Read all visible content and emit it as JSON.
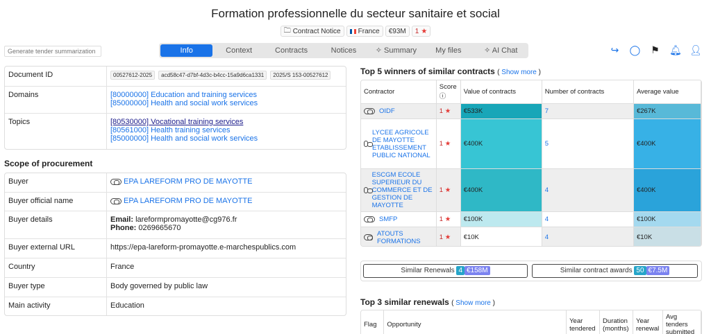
{
  "header": {
    "title": "Formation professionnelle du secteur sanitaire et social",
    "notice_type": "Contract Notice",
    "country": "France",
    "value": "€93M",
    "score": "1"
  },
  "summarize_placeholder": "Generate tender summarization",
  "tabs": [
    "Info",
    "Context",
    "Contracts",
    "Notices",
    "Summary",
    "My files",
    "AI Chat"
  ],
  "details": {
    "document_id_label": "Document ID",
    "document_ids": [
      "00527612-2025",
      "acd58c47-d7bf-4d3c-b4cc-15a9d6ca1331",
      "2025/S 153-00527612"
    ],
    "domains_label": "Domains",
    "domains": [
      "[80000000] Education and training services",
      "[85000000] Health and social work services"
    ],
    "topics_label": "Topics",
    "topics": [
      "[80530000] Vocational training services",
      "[80561000] Health training services",
      "[85000000] Health and social work services"
    ]
  },
  "scope": {
    "heading": "Scope of procurement",
    "buyer_label": "Buyer",
    "buyer": "EPA LAREFORM PRO DE MAYOTTE",
    "buyer_official_label": "Buyer official name",
    "buyer_official": "EPA LAREFORM PRO DE MAYOTTE",
    "buyer_details_label": "Buyer details",
    "email_label": "Email:",
    "email": "lareformpromayotte@cg976.fr",
    "phone_label": "Phone:",
    "phone": "0269665670",
    "url_label": "Buyer external URL",
    "url": "https://epa-lareform-promayotte.e-marchespublics.com",
    "country_label": "Country",
    "country": "France",
    "type_label": "Buyer type",
    "type": "Body governed by public law",
    "activity_label": "Main activity",
    "activity": "Education"
  },
  "winners": {
    "heading": "Top 5 winners of similar contracts",
    "show_more": "Show more",
    "headers": [
      "Contractor",
      "Score",
      "Value of contracts",
      "Number of contracts",
      "Average value"
    ],
    "rows": [
      {
        "name": "OIDF",
        "score": "1",
        "value": "€533K",
        "count": "7",
        "avg": "€267K"
      },
      {
        "name": "LYCEE AGRICOLE DE MAYOTTE ETABLISSEMENT PUBLIC NATIONAL",
        "score": "1",
        "value": "€400K",
        "count": "5",
        "avg": "€400K"
      },
      {
        "name": "ESCGM ECOLE SUPERIEUR DU COMMERCE ET DE GESTION DE MAYOTTE",
        "score": "1",
        "value": "€400K",
        "count": "4",
        "avg": "€400K"
      },
      {
        "name": "SMFP",
        "score": "1",
        "value": "€100K",
        "count": "4",
        "avg": "€100K"
      },
      {
        "name": "ATOUTS FORMATIONS",
        "score": "1",
        "value": "€10K",
        "count": "4",
        "avg": "€10K"
      }
    ],
    "value_colors": [
      "#18a6b8",
      "#37c5d4",
      "#2fb8c6",
      "#bde9ef",
      "#ffffff"
    ],
    "avg_colors": [
      "#58b9d8",
      "#37b1e6",
      "#2aa3da",
      "#a4d9ef",
      "#c9dfe6"
    ]
  },
  "similar": {
    "renewals_label": "Similar Renewals",
    "renewals_count": "4",
    "renewals_amount": "€158M",
    "awards_label": "Similar contract awards",
    "awards_count": "50",
    "awards_amount": "€7.5M"
  },
  "renewals": {
    "heading": "Top 3 similar renewals",
    "show_more": "Show more",
    "headers": [
      "Flag",
      "Opportunity",
      "Year tendered",
      "Duration (months)",
      "Year renewal",
      "Avg tenders submitted"
    ]
  }
}
